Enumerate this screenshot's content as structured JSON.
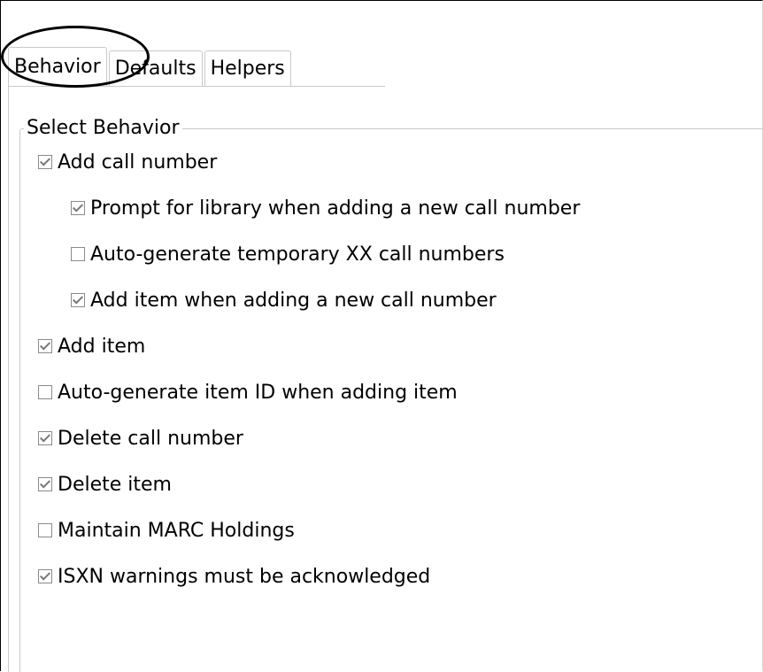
{
  "tabs": [
    {
      "label": "Behavior",
      "active": true
    },
    {
      "label": "Defaults",
      "active": false
    },
    {
      "label": "Helpers",
      "active": false
    }
  ],
  "group": {
    "title": "Select Behavior"
  },
  "options": [
    {
      "label": "Add call number",
      "checked": true
    },
    {
      "label": "Prompt for library when adding a new call number",
      "checked": true
    },
    {
      "label": "Auto-generate temporary XX call numbers",
      "checked": false
    },
    {
      "label": "Add item when adding a new call number",
      "checked": true
    },
    {
      "label": "Add item",
      "checked": true
    },
    {
      "label": "Auto-generate item ID when adding item",
      "checked": false
    },
    {
      "label": "Delete call number",
      "checked": true
    },
    {
      "label": "Delete item",
      "checked": true
    },
    {
      "label": "Maintain MARC Holdings",
      "checked": false
    },
    {
      "label": "ISXN warnings must be acknowledged",
      "checked": true
    }
  ],
  "colors": {
    "border": "#c9c9c9",
    "checkmark": "#777777",
    "annotation": "#000000"
  }
}
